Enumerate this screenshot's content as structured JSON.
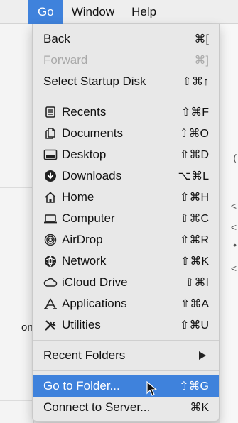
{
  "menubar": {
    "items": [
      {
        "label": "Go",
        "active": true
      },
      {
        "label": "Window",
        "active": false
      },
      {
        "label": "Help",
        "active": false
      }
    ]
  },
  "background": {
    "side_text": "on",
    "right_marks": [
      "(",
      "<",
      "<",
      "•",
      "<"
    ]
  },
  "go_menu": {
    "nav": [
      {
        "label": "Back",
        "shortcut": "⌘[",
        "enabled": true
      },
      {
        "label": "Forward",
        "shortcut": "⌘]",
        "enabled": false
      },
      {
        "label": "Select Startup Disk",
        "shortcut": "⇧⌘↑",
        "enabled": true
      }
    ],
    "places": [
      {
        "label": "Recents",
        "shortcut": "⇧⌘F",
        "icon": "recents-icon"
      },
      {
        "label": "Documents",
        "shortcut": "⇧⌘O",
        "icon": "documents-icon"
      },
      {
        "label": "Desktop",
        "shortcut": "⇧⌘D",
        "icon": "desktop-icon"
      },
      {
        "label": "Downloads",
        "shortcut": "⌥⌘L",
        "icon": "downloads-icon"
      },
      {
        "label": "Home",
        "shortcut": "⇧⌘H",
        "icon": "home-icon"
      },
      {
        "label": "Computer",
        "shortcut": "⇧⌘C",
        "icon": "computer-icon"
      },
      {
        "label": "AirDrop",
        "shortcut": "⇧⌘R",
        "icon": "airdrop-icon"
      },
      {
        "label": "Network",
        "shortcut": "⇧⌘K",
        "icon": "network-icon"
      },
      {
        "label": "iCloud Drive",
        "shortcut": "⇧⌘I",
        "icon": "icloud-drive-icon"
      },
      {
        "label": "Applications",
        "shortcut": "⇧⌘A",
        "icon": "applications-icon"
      },
      {
        "label": "Utilities",
        "shortcut": "⇧⌘U",
        "icon": "utilities-icon"
      }
    ],
    "recent_folders": {
      "label": "Recent Folders",
      "submenu_icon": "chevron-right-icon"
    },
    "bottom": [
      {
        "label": "Go to Folder...",
        "shortcut": "⇧⌘G",
        "highlighted": true
      },
      {
        "label": "Connect to Server...",
        "shortcut": "⌘K",
        "highlighted": false
      }
    ]
  },
  "colors": {
    "highlight": "#3f82dc",
    "disabled_text": "#a9a9a9",
    "menu_bg": "#e8e8e8"
  }
}
